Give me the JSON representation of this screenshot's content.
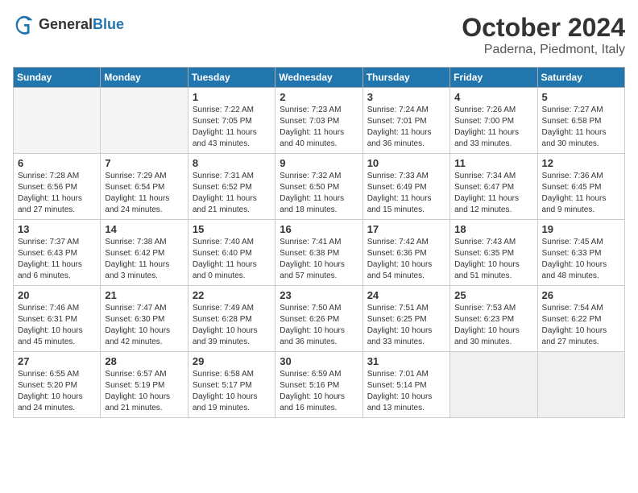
{
  "logo": {
    "general": "General",
    "blue": "Blue"
  },
  "header": {
    "month": "October 2024",
    "location": "Paderna, Piedmont, Italy"
  },
  "weekdays": [
    "Sunday",
    "Monday",
    "Tuesday",
    "Wednesday",
    "Thursday",
    "Friday",
    "Saturday"
  ],
  "weeks": [
    [
      {
        "day": "",
        "info": "",
        "empty": true
      },
      {
        "day": "",
        "info": "",
        "empty": true
      },
      {
        "day": "1",
        "info": "Sunrise: 7:22 AM\nSunset: 7:05 PM\nDaylight: 11 hours\nand 43 minutes."
      },
      {
        "day": "2",
        "info": "Sunrise: 7:23 AM\nSunset: 7:03 PM\nDaylight: 11 hours\nand 40 minutes."
      },
      {
        "day": "3",
        "info": "Sunrise: 7:24 AM\nSunset: 7:01 PM\nDaylight: 11 hours\nand 36 minutes."
      },
      {
        "day": "4",
        "info": "Sunrise: 7:26 AM\nSunset: 7:00 PM\nDaylight: 11 hours\nand 33 minutes."
      },
      {
        "day": "5",
        "info": "Sunrise: 7:27 AM\nSunset: 6:58 PM\nDaylight: 11 hours\nand 30 minutes."
      }
    ],
    [
      {
        "day": "6",
        "info": "Sunrise: 7:28 AM\nSunset: 6:56 PM\nDaylight: 11 hours\nand 27 minutes."
      },
      {
        "day": "7",
        "info": "Sunrise: 7:29 AM\nSunset: 6:54 PM\nDaylight: 11 hours\nand 24 minutes."
      },
      {
        "day": "8",
        "info": "Sunrise: 7:31 AM\nSunset: 6:52 PM\nDaylight: 11 hours\nand 21 minutes."
      },
      {
        "day": "9",
        "info": "Sunrise: 7:32 AM\nSunset: 6:50 PM\nDaylight: 11 hours\nand 18 minutes."
      },
      {
        "day": "10",
        "info": "Sunrise: 7:33 AM\nSunset: 6:49 PM\nDaylight: 11 hours\nand 15 minutes."
      },
      {
        "day": "11",
        "info": "Sunrise: 7:34 AM\nSunset: 6:47 PM\nDaylight: 11 hours\nand 12 minutes."
      },
      {
        "day": "12",
        "info": "Sunrise: 7:36 AM\nSunset: 6:45 PM\nDaylight: 11 hours\nand 9 minutes."
      }
    ],
    [
      {
        "day": "13",
        "info": "Sunrise: 7:37 AM\nSunset: 6:43 PM\nDaylight: 11 hours\nand 6 minutes."
      },
      {
        "day": "14",
        "info": "Sunrise: 7:38 AM\nSunset: 6:42 PM\nDaylight: 11 hours\nand 3 minutes."
      },
      {
        "day": "15",
        "info": "Sunrise: 7:40 AM\nSunset: 6:40 PM\nDaylight: 11 hours\nand 0 minutes."
      },
      {
        "day": "16",
        "info": "Sunrise: 7:41 AM\nSunset: 6:38 PM\nDaylight: 10 hours\nand 57 minutes."
      },
      {
        "day": "17",
        "info": "Sunrise: 7:42 AM\nSunset: 6:36 PM\nDaylight: 10 hours\nand 54 minutes."
      },
      {
        "day": "18",
        "info": "Sunrise: 7:43 AM\nSunset: 6:35 PM\nDaylight: 10 hours\nand 51 minutes."
      },
      {
        "day": "19",
        "info": "Sunrise: 7:45 AM\nSunset: 6:33 PM\nDaylight: 10 hours\nand 48 minutes."
      }
    ],
    [
      {
        "day": "20",
        "info": "Sunrise: 7:46 AM\nSunset: 6:31 PM\nDaylight: 10 hours\nand 45 minutes."
      },
      {
        "day": "21",
        "info": "Sunrise: 7:47 AM\nSunset: 6:30 PM\nDaylight: 10 hours\nand 42 minutes."
      },
      {
        "day": "22",
        "info": "Sunrise: 7:49 AM\nSunset: 6:28 PM\nDaylight: 10 hours\nand 39 minutes."
      },
      {
        "day": "23",
        "info": "Sunrise: 7:50 AM\nSunset: 6:26 PM\nDaylight: 10 hours\nand 36 minutes."
      },
      {
        "day": "24",
        "info": "Sunrise: 7:51 AM\nSunset: 6:25 PM\nDaylight: 10 hours\nand 33 minutes."
      },
      {
        "day": "25",
        "info": "Sunrise: 7:53 AM\nSunset: 6:23 PM\nDaylight: 10 hours\nand 30 minutes."
      },
      {
        "day": "26",
        "info": "Sunrise: 7:54 AM\nSunset: 6:22 PM\nDaylight: 10 hours\nand 27 minutes."
      }
    ],
    [
      {
        "day": "27",
        "info": "Sunrise: 6:55 AM\nSunset: 5:20 PM\nDaylight: 10 hours\nand 24 minutes."
      },
      {
        "day": "28",
        "info": "Sunrise: 6:57 AM\nSunset: 5:19 PM\nDaylight: 10 hours\nand 21 minutes."
      },
      {
        "day": "29",
        "info": "Sunrise: 6:58 AM\nSunset: 5:17 PM\nDaylight: 10 hours\nand 19 minutes."
      },
      {
        "day": "30",
        "info": "Sunrise: 6:59 AM\nSunset: 5:16 PM\nDaylight: 10 hours\nand 16 minutes."
      },
      {
        "day": "31",
        "info": "Sunrise: 7:01 AM\nSunset: 5:14 PM\nDaylight: 10 hours\nand 13 minutes."
      },
      {
        "day": "",
        "info": "",
        "empty": true,
        "shaded": true
      },
      {
        "day": "",
        "info": "",
        "empty": true,
        "shaded": true
      }
    ]
  ]
}
